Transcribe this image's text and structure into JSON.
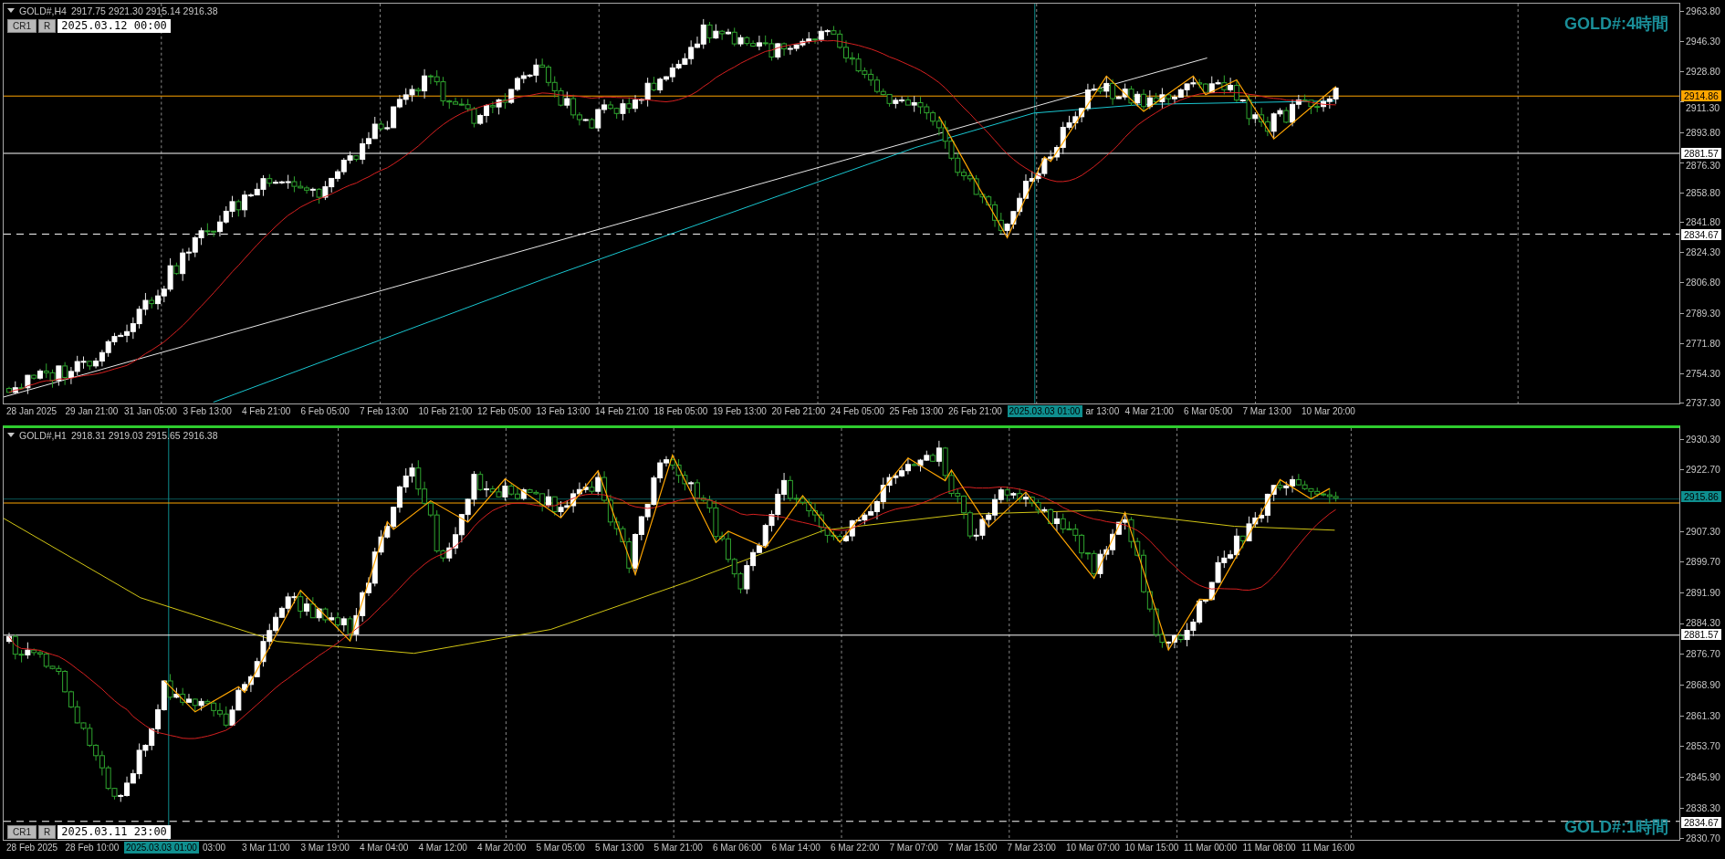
{
  "charts": [
    {
      "kind": "h4",
      "symbol": "GOLD#,H4",
      "quotes": "2917.75 2921.30 2915.14 2916.38",
      "buttons": [
        "CR1",
        "R"
      ],
      "cursor_time": "2025.03.12 00:00",
      "label": "GOLD#:4時間",
      "price_ticks": [
        "2963.80",
        "2946.30",
        "2928.80",
        "2911.30",
        "2893.80",
        "2876.30",
        "2858.80",
        "2841.80",
        "2824.30",
        "2806.80",
        "2789.30",
        "2771.80",
        "2754.30",
        "2737.30"
      ],
      "price_tags": [
        {
          "text": "2914.86",
          "color": "#ffa500",
          "kind": "solid"
        },
        {
          "text": "2881.57",
          "color": "#ffffff",
          "kind": "solid"
        },
        {
          "text": "2834.67",
          "color": "#ffffff",
          "kind": "dashed"
        }
      ],
      "time_labels": [
        {
          "text": "28 Jan 2025",
          "kind": "label"
        },
        {
          "text": "29 Jan 21:00",
          "kind": "label"
        },
        {
          "text": "31 Jan 05:00",
          "kind": "label"
        },
        {
          "text": "3 Feb 13:00",
          "kind": "label"
        },
        {
          "text": "4 Feb 21:00",
          "kind": "label"
        },
        {
          "text": "6 Feb 05:00",
          "kind": "label"
        },
        {
          "text": "7 Feb 13:00",
          "kind": "label"
        },
        {
          "text": "10 Feb 21:00",
          "kind": "label"
        },
        {
          "text": "12 Feb 05:00",
          "kind": "label"
        },
        {
          "text": "13 Feb 13:00",
          "kind": "label"
        },
        {
          "text": "14 Feb 21:00",
          "kind": "label"
        },
        {
          "text": "18 Feb 05:00",
          "kind": "label"
        },
        {
          "text": "19 Feb 13:00",
          "kind": "label"
        },
        {
          "text": "20 Feb 21:00",
          "kind": "label"
        },
        {
          "text": "24 Feb 05:00",
          "kind": "label"
        },
        {
          "text": "25 Feb 13:00",
          "kind": "label"
        },
        {
          "text": "26 Feb 21:00",
          "kind": "label"
        },
        {
          "text": "2025.03.03 01:00",
          "kind": "tag"
        },
        {
          "text": "ar 13:00",
          "kind": "label"
        },
        {
          "text": "4 Mar 21:00",
          "kind": "label"
        },
        {
          "text": "6 Mar 05:00",
          "kind": "label"
        },
        {
          "text": "7 Mar 13:00",
          "kind": "label"
        },
        {
          "text": "10 Mar 20:00",
          "kind": "label"
        }
      ]
    },
    {
      "kind": "h1",
      "symbol": "GOLD#,H1",
      "quotes": "2918.31 2919.03 2915.65 2916.38",
      "buttons": [
        "CR1",
        "R"
      ],
      "cursor_time": "2025.03.11 23:00",
      "label": "GOLD#:1時間",
      "price_ticks": [
        "2930.30",
        "2922.70",
        "2907.30",
        "2899.70",
        "2891.90",
        "2884.30",
        "2876.70",
        "2868.90",
        "2861.30",
        "2853.70",
        "2845.90",
        "2838.30",
        "2830.70"
      ],
      "price_tags": [
        {
          "text": "2915.86",
          "color": "#0f8f8f",
          "kind": "solid"
        },
        {
          "text": "2881.57",
          "color": "#ffffff",
          "kind": "solid"
        },
        {
          "text": "2834.67",
          "color": "#ffffff",
          "kind": "dashed"
        }
      ],
      "time_labels": [
        {
          "text": "28 Feb 2025",
          "kind": "label"
        },
        {
          "text": "28 Feb 10:00",
          "kind": "label"
        },
        {
          "text": "2025.03.03 01:00",
          "kind": "tag"
        },
        {
          "text": "03:00",
          "kind": "label"
        },
        {
          "text": "3 Mar 11:00",
          "kind": "label"
        },
        {
          "text": "3 Mar 19:00",
          "kind": "label"
        },
        {
          "text": "4 Mar 04:00",
          "kind": "label"
        },
        {
          "text": "4 Mar 12:00",
          "kind": "label"
        },
        {
          "text": "4 Mar 20:00",
          "kind": "label"
        },
        {
          "text": "5 Mar 05:00",
          "kind": "label"
        },
        {
          "text": "5 Mar 13:00",
          "kind": "label"
        },
        {
          "text": "5 Mar 21:00",
          "kind": "label"
        },
        {
          "text": "6 Mar 06:00",
          "kind": "label"
        },
        {
          "text": "6 Mar 14:00",
          "kind": "label"
        },
        {
          "text": "6 Mar 22:00",
          "kind": "label"
        },
        {
          "text": "7 Mar 07:00",
          "kind": "label"
        },
        {
          "text": "7 Mar 15:00",
          "kind": "label"
        },
        {
          "text": "7 Mar 23:00",
          "kind": "label"
        },
        {
          "text": "10 Mar 07:00",
          "kind": "label"
        },
        {
          "text": "10 Mar 15:00",
          "kind": "label"
        },
        {
          "text": "11 Mar 00:00",
          "kind": "label"
        },
        {
          "text": "11 Mar 08:00",
          "kind": "label"
        },
        {
          "text": "11 Mar 16:00",
          "kind": "label"
        }
      ]
    }
  ]
}
